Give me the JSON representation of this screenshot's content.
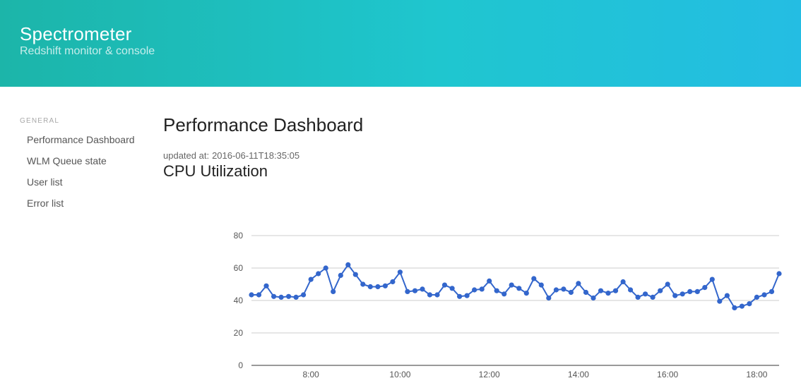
{
  "header": {
    "title": "Spectrometer",
    "subtitle": "Redshift monitor & console"
  },
  "sidebar": {
    "heading": "GENERAL",
    "items": [
      {
        "label": "Performance Dashboard"
      },
      {
        "label": "WLM Queue state"
      },
      {
        "label": "User list"
      },
      {
        "label": "Error list"
      }
    ]
  },
  "main": {
    "title": "Performance Dashboard",
    "updated_label": "updated at:",
    "updated_value": "2016-06-11T18:35:05"
  },
  "chart_data": {
    "type": "line",
    "title": "CPU Utilization",
    "xlabel": "",
    "ylabel": "",
    "ylim": [
      0,
      80
    ],
    "yticks": [
      0,
      20,
      40,
      60,
      80
    ],
    "xlim": [
      "6:40",
      "18:30"
    ],
    "xticks": [
      "8:00",
      "10:00",
      "12:00",
      "14:00",
      "16:00",
      "18:00"
    ],
    "grid": true,
    "color": "#3366cc",
    "series": [
      {
        "x": [
          "6:40",
          "6:50",
          "7:00",
          "7:10",
          "7:20",
          "7:30",
          "7:40",
          "7:50",
          "8:00",
          "8:10",
          "8:20",
          "8:30",
          "8:40",
          "8:50",
          "9:00",
          "9:10",
          "9:20",
          "9:30",
          "9:40",
          "9:50",
          "10:00",
          "10:10",
          "10:20",
          "10:30",
          "10:40",
          "10:50",
          "11:00",
          "11:10",
          "11:20",
          "11:30",
          "11:40",
          "11:50",
          "12:00",
          "12:10",
          "12:20",
          "12:30",
          "12:40",
          "12:50",
          "13:00",
          "13:10",
          "13:20",
          "13:30",
          "13:40",
          "13:50",
          "14:00",
          "14:10",
          "14:20",
          "14:30",
          "14:40",
          "14:50",
          "15:00",
          "15:10",
          "15:20",
          "15:30",
          "15:40",
          "15:50",
          "16:00",
          "16:10",
          "16:20",
          "16:30",
          "16:40",
          "16:50",
          "17:00",
          "17:10",
          "17:20",
          "17:30",
          "17:40",
          "17:50",
          "18:00",
          "18:10",
          "18:20",
          "18:30"
        ],
        "values": [
          43.5,
          43.5,
          49,
          42.5,
          42,
          42.5,
          42,
          43.5,
          53,
          56.5,
          60,
          45.5,
          55.5,
          62,
          56,
          50,
          48.5,
          48.5,
          49,
          51.5,
          57.5,
          45.5,
          46,
          47,
          43.5,
          43.5,
          49.5,
          47.5,
          42.5,
          43,
          46.5,
          47,
          52,
          46,
          44,
          49.5,
          47.5,
          44.5,
          53.5,
          49.5,
          41.5,
          46.5,
          47,
          45,
          50.5,
          45,
          41.5,
          46,
          44.5,
          46,
          51.5,
          46.5,
          42,
          44,
          42,
          46,
          50,
          43,
          44,
          45.5,
          45.5,
          48,
          53,
          39.5,
          43,
          35.5,
          36.5,
          38,
          42,
          43.5,
          45.5,
          56.5
        ]
      }
    ]
  }
}
